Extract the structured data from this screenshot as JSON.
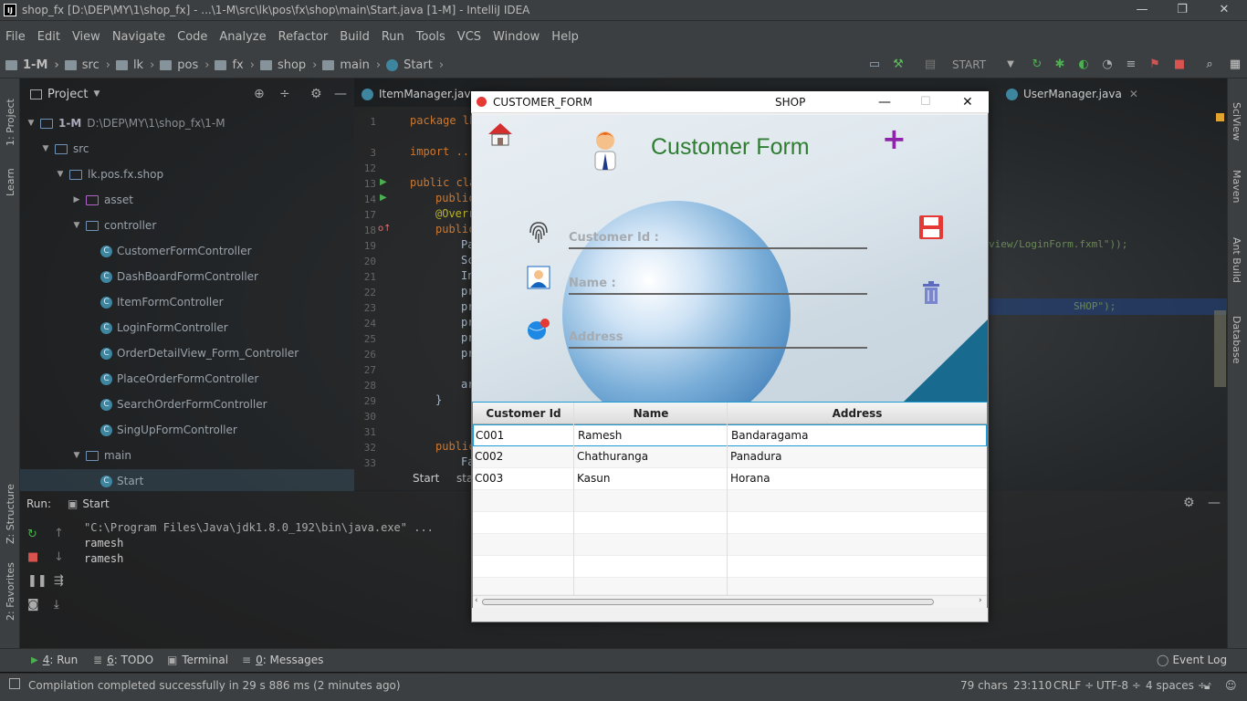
{
  "window": {
    "title": "shop_fx [D:\\DEP\\MY\\1\\shop_fx] - ...\\1-M\\src\\lk\\pos\\fx\\shop\\main\\Start.java [1-M] - IntelliJ IDEA",
    "logo": "IJ"
  },
  "menu": [
    "File",
    "Edit",
    "View",
    "Navigate",
    "Code",
    "Analyze",
    "Refactor",
    "Build",
    "Run",
    "Tools",
    "VCS",
    "Window",
    "Help"
  ],
  "breadcrumb": [
    "1-M",
    "src",
    "lk",
    "pos",
    "fx",
    "shop",
    "main",
    "Start"
  ],
  "toolbar": {
    "run_config": "START"
  },
  "left_strip": {
    "project": "1: Project",
    "learn": "Learn",
    "structure": "Z: Structure",
    "favorites": "2: Favorites"
  },
  "right_strip": {
    "sciview": "SciView",
    "maven": "Maven",
    "ant": "Ant Build",
    "database": "Database"
  },
  "project": {
    "title": "Project",
    "tree": [
      {
        "label": "1-M",
        "extra": "D:\\DEP\\MY\\1\\shop_fx\\1-M"
      },
      {
        "label": "src"
      },
      {
        "label": "lk.pos.fx.shop"
      },
      {
        "label": "asset"
      },
      {
        "label": "controller"
      },
      {
        "label": "CustomerFormController"
      },
      {
        "label": "DashBoardFormController"
      },
      {
        "label": "ItemFormController"
      },
      {
        "label": "LoginFormController"
      },
      {
        "label": "OrderDetailView_Form_Controller"
      },
      {
        "label": "PlaceOrderFormController"
      },
      {
        "label": "SearchOrderFormController"
      },
      {
        "label": "SingUpFormController"
      },
      {
        "label": "main"
      },
      {
        "label": "Start"
      }
    ]
  },
  "editor": {
    "tabs": [
      "ItemManager.java",
      "UserManager.java"
    ],
    "line_numbers": [
      "1",
      "3",
      "12",
      "13",
      "14",
      "17",
      "18",
      "19",
      "20",
      "21",
      "22",
      "23",
      "24",
      "25",
      "26",
      "27",
      "28",
      "29",
      "30",
      "31",
      "32",
      "33"
    ],
    "code": [
      "package lk",
      "import ...",
      "public cla",
      "public",
      "@Overr",
      "public",
      "Pa",
      "Sc",
      "In",
      "pr",
      "pr",
      "pr",
      "pr",
      "pr",
      "ar",
      "}",
      "public",
      "Fa"
    ],
    "right_code": "view/LoginForm.fxml\"));",
    "right_code2": "SHOP\");",
    "breadcrumb": [
      "Start",
      "sta"
    ]
  },
  "run": {
    "label": "Run:",
    "config": "Start",
    "lines": [
      "\"C:\\Program Files\\Java\\jdk1.8.0_192\\bin\\java.exe\" ...",
      "ramesh",
      "ramesh"
    ]
  },
  "bottom_tabs": [
    {
      "num": "4",
      "label": ": Run"
    },
    {
      "num": "6",
      "label": ": TODO"
    },
    {
      "num": "",
      "label": "Terminal"
    },
    {
      "num": "0",
      "label": ": Messages"
    }
  ],
  "event_log": "Event Log",
  "status": {
    "message": "Compilation completed successfully in 29 s 886 ms (2 minutes ago)",
    "chars": "79 chars",
    "position": "23:110",
    "line_sep": "CRLF",
    "encoding": "UTF-8",
    "indent": "4 spaces"
  },
  "modal": {
    "title": "CUSTOMER_FORM",
    "center_title": "SHOP",
    "heading": "Customer Form",
    "fields": {
      "id": "Customer Id :",
      "name": "Name  :",
      "address": "Address"
    },
    "columns": [
      "Customer Id",
      "Name",
      "Address"
    ],
    "rows": [
      [
        "C001",
        "Ramesh",
        "Bandaragama"
      ],
      [
        "C002",
        "Chathuranga",
        "Panadura"
      ],
      [
        "C003",
        "Kasun",
        "Horana"
      ]
    ],
    "heading_color": "#2e7d32"
  }
}
